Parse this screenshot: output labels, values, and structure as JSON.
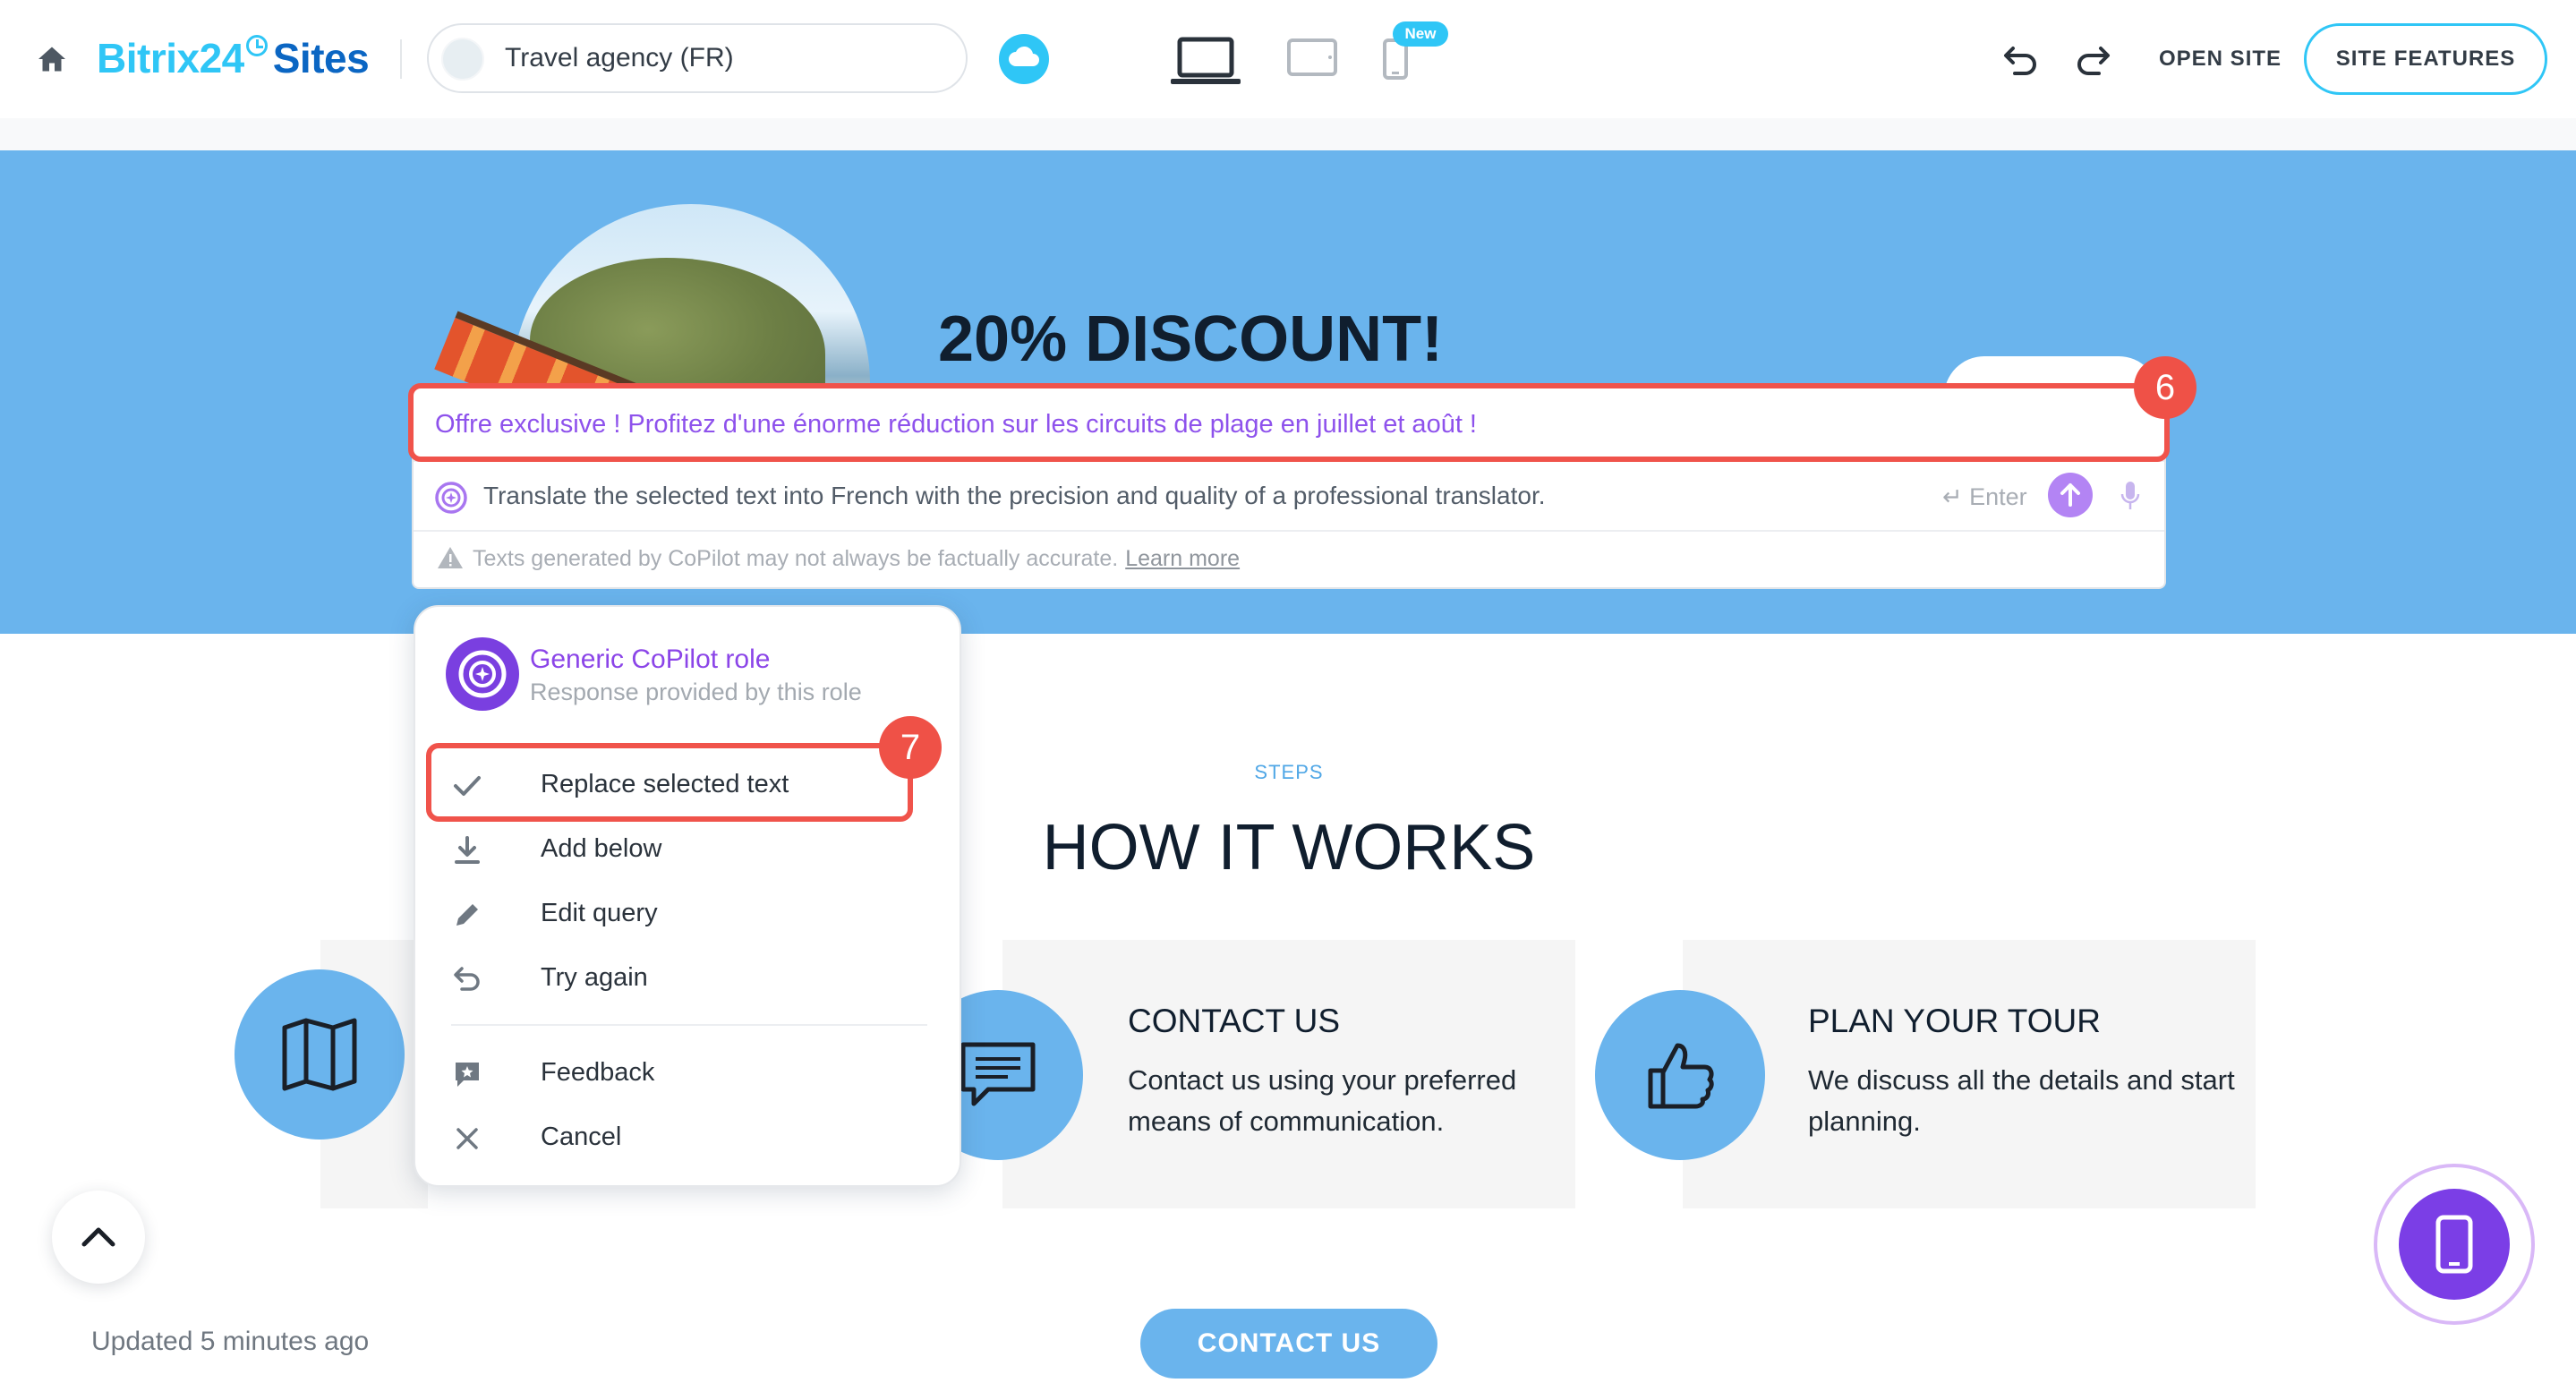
{
  "header": {
    "brand_part1": "Bitrix24",
    "brand_part2": "Sites",
    "site_name": "Travel agency (FR)",
    "new_badge": "New",
    "open_site": "OPEN SITE",
    "site_features": "SITE FEATURES"
  },
  "hero": {
    "title": "20% DISCOUNT!"
  },
  "copilot": {
    "result_text": "Offre exclusive ! Profitez d'une énorme réduction sur les circuits de plage en juillet et août !",
    "query_text": "Translate the selected text into French with the precision and quality of a professional translator.",
    "enter_hint": "↵ Enter",
    "disclaimer": "Texts generated by CoPilot may not always be factually accurate.",
    "learn_more": "Learn more",
    "callout_result": "6"
  },
  "role_menu": {
    "role_name": "Generic CoPilot role",
    "role_subtitle": "Response provided by this role",
    "callout_replace": "7",
    "items": [
      {
        "label": "Replace selected text",
        "icon": "check-icon"
      },
      {
        "label": "Add below",
        "icon": "download-icon"
      },
      {
        "label": "Edit query",
        "icon": "pencil-icon"
      },
      {
        "label": "Try again",
        "icon": "undo-arrow-icon"
      },
      {
        "label": "Feedback",
        "icon": "feedback-icon"
      },
      {
        "label": "Cancel",
        "icon": "close-icon"
      }
    ]
  },
  "steps": {
    "label": "STEPS",
    "title": "HOW IT WORKS",
    "cards": [
      {
        "title": "CONTACT US",
        "text": "Contact us using your preferred means of communication."
      },
      {
        "title": "PLAN YOUR TOUR",
        "text": "We discuss all the details and start planning."
      }
    ],
    "cta": "CONTACT US"
  },
  "footer": {
    "updated": "Updated 5 minutes ago"
  },
  "colors": {
    "accent": "#2fc6f6",
    "hero_bg": "#6ab4ed",
    "copilot_purple": "#8e52ec",
    "callout_red": "#ef5147"
  }
}
